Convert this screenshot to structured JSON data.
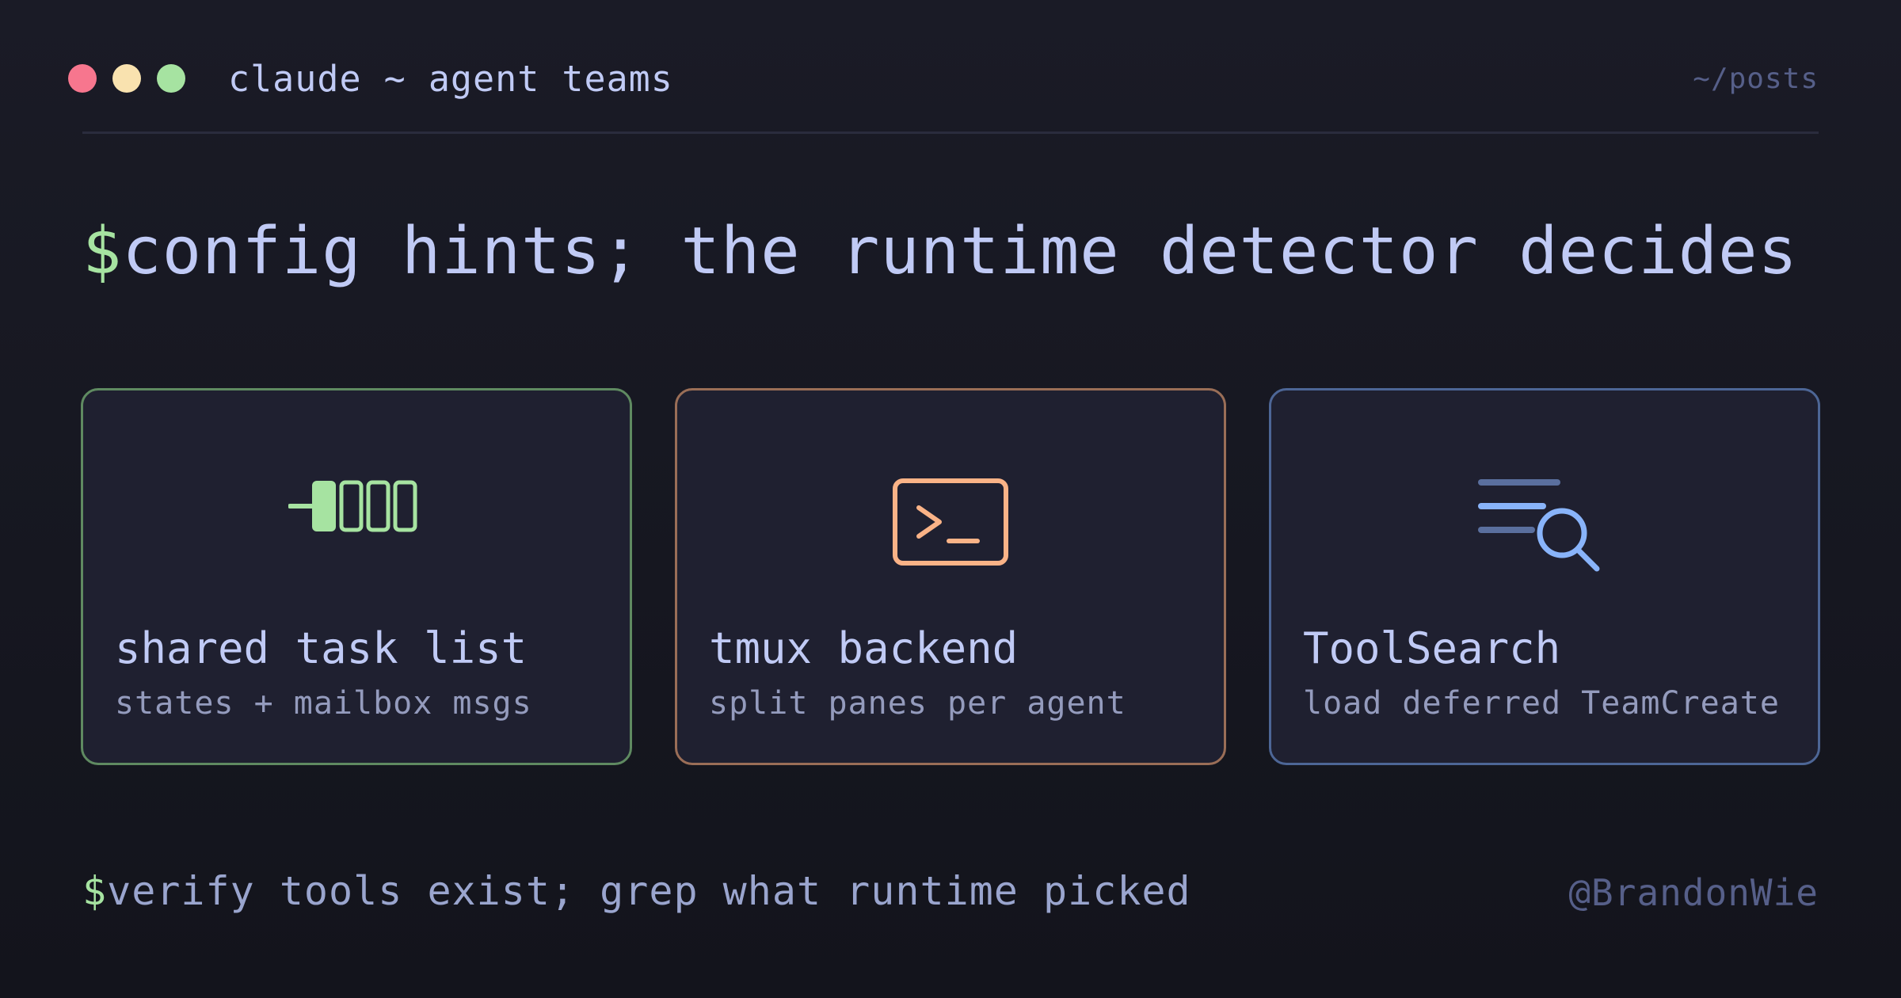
{
  "window": {
    "title": "claude ~ agent teams",
    "path": "~/posts",
    "controls": [
      "close",
      "minimize",
      "maximize"
    ]
  },
  "headline": {
    "prompt": "$",
    "text": "config hints; the runtime detector decides"
  },
  "cards": [
    {
      "title": "shared task list",
      "subtitle": "states + mailbox msgs",
      "icon": "task-queue-icon",
      "accent": "#a6e3a1"
    },
    {
      "title": "tmux backend",
      "subtitle": "split panes per agent",
      "icon": "terminal-icon",
      "accent": "#fab387"
    },
    {
      "title": "ToolSearch",
      "subtitle": "load deferred TeamCreate",
      "icon": "list-search-icon",
      "accent": "#89b4fa"
    }
  ],
  "footer": {
    "prompt": "$",
    "text": "verify tools exist; grep what runtime picked",
    "handle": "@BrandonWie"
  },
  "colors": {
    "background": "#1a1b26",
    "text": "#c0caf5",
    "prompt_green": "#a6e3a1",
    "muted": "#565f89"
  }
}
